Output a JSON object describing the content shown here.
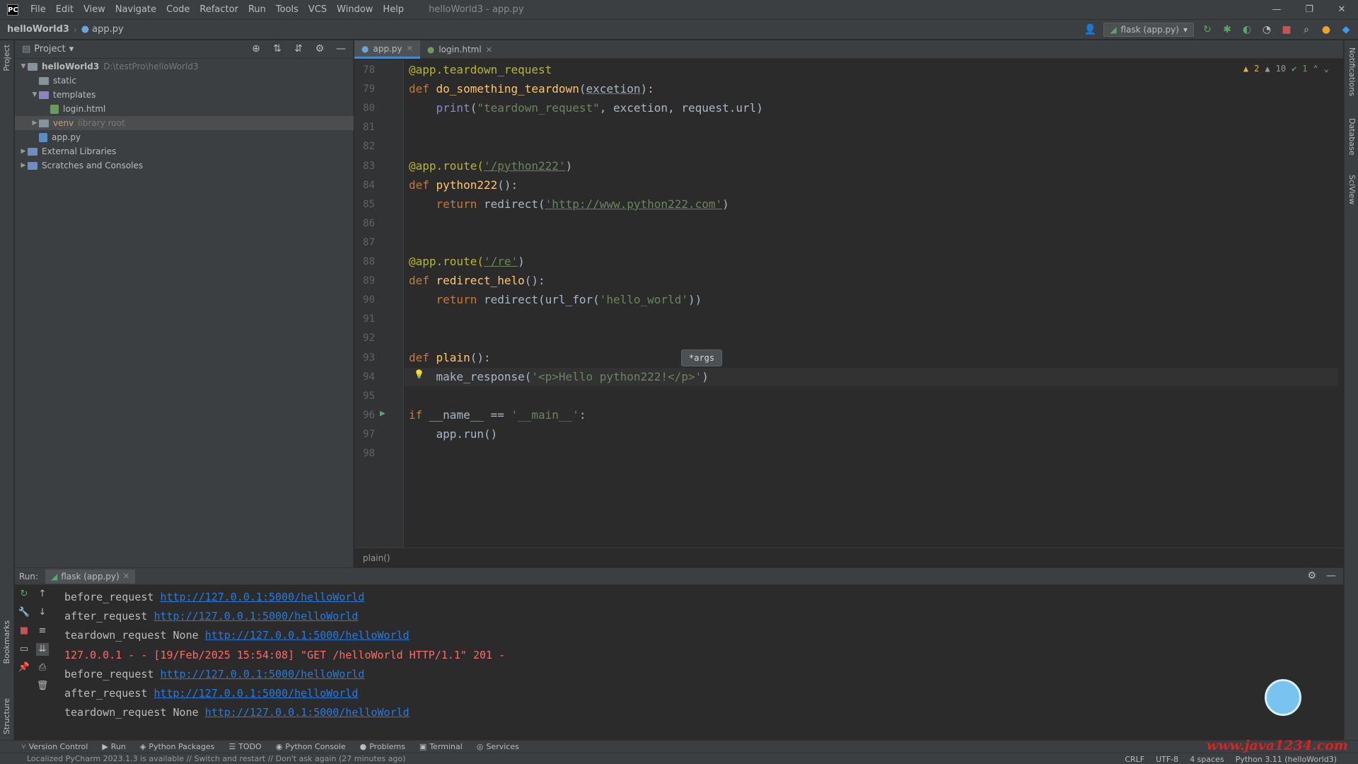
{
  "menubar": {
    "items": [
      "File",
      "Edit",
      "View",
      "Navigate",
      "Code",
      "Refactor",
      "Run",
      "Tools",
      "VCS",
      "Window",
      "Help"
    ],
    "window_title": "helloWorld3 - app.py"
  },
  "navbar": {
    "project": "helloWorld3",
    "file": "app.py",
    "run_config": "flask (app.py)"
  },
  "project_panel": {
    "title": "Project",
    "tree": [
      {
        "label": "helloWorld3",
        "hint": "D:\\testPro\\helloWorld3"
      },
      {
        "label": "static",
        "hint": ""
      },
      {
        "label": "templates",
        "hint": ""
      },
      {
        "label": "login.html",
        "hint": ""
      },
      {
        "label": "venv",
        "hint": "library root"
      },
      {
        "label": "app.py",
        "hint": ""
      },
      {
        "label": "External Libraries",
        "hint": ""
      },
      {
        "label": "Scratches and Consoles",
        "hint": ""
      }
    ]
  },
  "editor": {
    "tabs": [
      {
        "label": "app.py"
      },
      {
        "label": "login.html"
      }
    ],
    "inspection": {
      "warnings": "2",
      "weak": "10",
      "ok": "1"
    },
    "param_hint": "*args",
    "breadcrumb": "plain()",
    "lines": [
      {
        "n": "78",
        "dec": "@app.teardown_request"
      },
      {
        "n": "79",
        "kw": "def ",
        "fn": "do_something_teardown",
        "rest": "(",
        "param": "excetion",
        "rest2": "):"
      },
      {
        "n": "80",
        "indent": "    ",
        "builtin": "print",
        "rest": "(",
        "str": "\"teardown_request\"",
        "rest2": ", excetion, request.url)"
      },
      {
        "n": "81"
      },
      {
        "n": "82"
      },
      {
        "n": "83",
        "dec": "@app.route(",
        "str": "'/python222'",
        "rest2": ")"
      },
      {
        "n": "84",
        "kw": "def ",
        "fn": "python222",
        "rest": "():"
      },
      {
        "n": "85",
        "indent": "    ",
        "kw": "return ",
        "rest": "redirect(",
        "str": "'http://www.python222.com'",
        "rest2": ")"
      },
      {
        "n": "86"
      },
      {
        "n": "87"
      },
      {
        "n": "88",
        "dec": "@app.route(",
        "str": "'/re'",
        "rest2": ")"
      },
      {
        "n": "89",
        "kw": "def ",
        "fn": "redirect_helo",
        "rest": "():"
      },
      {
        "n": "90",
        "indent": "    ",
        "kw": "return ",
        "rest": "redirect(url_for(",
        "str": "'hello_world'",
        "rest2": "))"
      },
      {
        "n": "91"
      },
      {
        "n": "92"
      },
      {
        "n": "93",
        "kw": "def ",
        "fn": "plain",
        "rest": "():"
      },
      {
        "n": "94",
        "indent": "    ",
        "rest": "make_response(",
        "str": "'<p>Hello python222!</p>'",
        "rest2": ")"
      },
      {
        "n": "95"
      },
      {
        "n": "96",
        "kw": "if ",
        "rest": "__name__ == ",
        "str": "'__main__'",
        "rest2": ":"
      },
      {
        "n": "97",
        "indent": "    ",
        "rest": "app.run()"
      },
      {
        "n": "98"
      }
    ]
  },
  "run_panel": {
    "label": "Run:",
    "tab": "flask (app.py)",
    "output": [
      {
        "text": "before_request ",
        "link": "http://127.0.0.1:5000/helloWorld",
        "type": "normal"
      },
      {
        "text": "after_request ",
        "link": "http://127.0.0.1:5000/helloWorld",
        "type": "normal"
      },
      {
        "text": "teardown_request None ",
        "link": "http://127.0.0.1:5000/helloWorld",
        "type": "normal"
      },
      {
        "text": "127.0.0.1 - - [19/Feb/2025 15:54:08] \"GET /helloWorld HTTP/1.1\" 201 -",
        "link": "",
        "type": "error"
      },
      {
        "text": "before_request ",
        "link": "http://127.0.0.1:5000/helloWorld",
        "type": "normal"
      },
      {
        "text": "after_request ",
        "link": "http://127.0.0.1:5000/helloWorld",
        "type": "normal"
      },
      {
        "text": "teardown_request None ",
        "link": "http://127.0.0.1:5000/helloWorld",
        "type": "normal"
      }
    ]
  },
  "tool_bar": {
    "tabs": [
      "Version Control",
      "Run",
      "Python Packages",
      "TODO",
      "Python Console",
      "Problems",
      "Terminal",
      "Services"
    ]
  },
  "status_bar": {
    "message": "Localized PyCharm 2023.1.3 is available // Switch and restart // Don't ask again (27 minutes ago)",
    "line_sep": "CRLF",
    "encoding": "UTF-8",
    "indent": "4 spaces",
    "interpreter": "Python 3.11 (helloWorld3)"
  },
  "watermark": "www.java1234.com",
  "colors": {
    "accent": "#4a88c7",
    "keyword": "#cc7832",
    "decorator": "#bbb529",
    "function": "#ffc66d",
    "string": "#6a8759",
    "link": "#287bde",
    "error": "#ff6b68"
  }
}
